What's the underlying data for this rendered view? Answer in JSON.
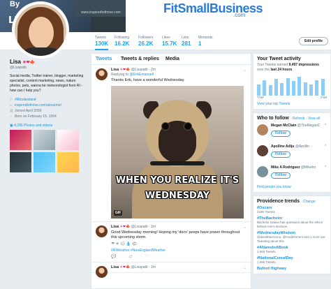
{
  "banner": {
    "by_text": "By",
    "li_text": "Li",
    "site_text": "www.inspiredtothrive.com",
    "logo": "FitSmallBusiness",
    "logo_suffix": ".com"
  },
  "stats": [
    {
      "label": "Tweets",
      "value": "130K"
    },
    {
      "label": "Following",
      "value": "16.2K"
    },
    {
      "label": "Followers",
      "value": "26.2K"
    },
    {
      "label": "Likes",
      "value": "15.7K"
    },
    {
      "label": "Lists",
      "value": "281"
    },
    {
      "label": "Moments",
      "value": "1"
    }
  ],
  "edit_profile_label": "Edit profile",
  "profile": {
    "name": "Lisa",
    "name_emojis": "☀❤🍁",
    "handle": "@Lisapatb",
    "bio": "Social media, Twitter trainer, blogger, marketing specialist, content marketing, news, nature photos, pets, wanna be meteorologist from RI - how can I help you?",
    "location": "#Rhodeisland",
    "website": "inspiredtothrive.com/aboutme/",
    "joined": "Joined April 2009",
    "born": "Born on February 15, 1964",
    "photos_link": "4,286 Photos and videos"
  },
  "tabs": [
    "Tweets",
    "Tweets & replies",
    "Media"
  ],
  "tweets": [
    {
      "name": "Lisa",
      "emojis": "☀❤🍁",
      "handle": "@Lisapatb · 2m",
      "replying_prefix": "Replying to",
      "replying_to": "@ErikEmanuell",
      "text": "Thanks Erik, have a wonderful Wednesday.",
      "gif_top": "WHEN YOU REALIZE IT'S",
      "gif_bottom": "WEDNESDAY",
      "gif_badge": "GIF"
    },
    {
      "name": "Lisa",
      "emojis": "☀❤🍁",
      "handle": "@Lisapatb · 2m",
      "text": "Good Wednesday morning! Hoping my 'docs' peeps have power throughout this upcoming storm.",
      "weather": "☂☀🌧💧🌤",
      "tags": "#RIWeather #NewEnglandWeather"
    },
    {
      "name": "Lisa",
      "emojis": "☀❤🍁",
      "handle": "@Lisapatb · 2m"
    }
  ],
  "activity": {
    "title": "Your Tweet activity",
    "summary_prefix": "Your Tweets earned",
    "impressions": "9,497 impressions",
    "summary_mid": "over the",
    "period": "last 24 hours",
    "bars": [
      0.55,
      0.75,
      0.5,
      0.8,
      0.6,
      0.85,
      0.7,
      0.9,
      0.65,
      0.55,
      0.75,
      0.8
    ],
    "date_left": "7AM",
    "date_right": "7AM",
    "link": "View your top Tweets"
  },
  "who_to_follow": {
    "title": "Who to follow",
    "refresh": "· Refresh · View all",
    "items": [
      {
        "name": "Megan McClain",
        "handle": "@TheMeganC"
      },
      {
        "name": "Apolline Adiju",
        "handle": "@Apollin"
      },
      {
        "name": "Mike A Rodriguez",
        "handle": "@Miketro"
      }
    ],
    "follow_label": "Follow",
    "find_link": "Find people you know"
  },
  "trends": {
    "title": "Providence trends",
    "change": "· Change",
    "items": [
      {
        "name": "#Oscars",
        "desc": "218K Tweets"
      },
      {
        "name": "#TheBachelor",
        "desc": "Bachelor Nation has questions about the ethics behind Arie's decision"
      },
      {
        "name": "#WednesdayWisdom",
        "desc": "@davidharrisonu, @modelement and 1 more are Tweeting about this"
      },
      {
        "name": "#ANameInABook",
        "desc": "1,666 Tweets"
      },
      {
        "name": "#NationalCerealDay",
        "desc": "1,666 Tweets"
      },
      {
        "name": "Buford Highway",
        "desc": ""
      }
    ]
  }
}
